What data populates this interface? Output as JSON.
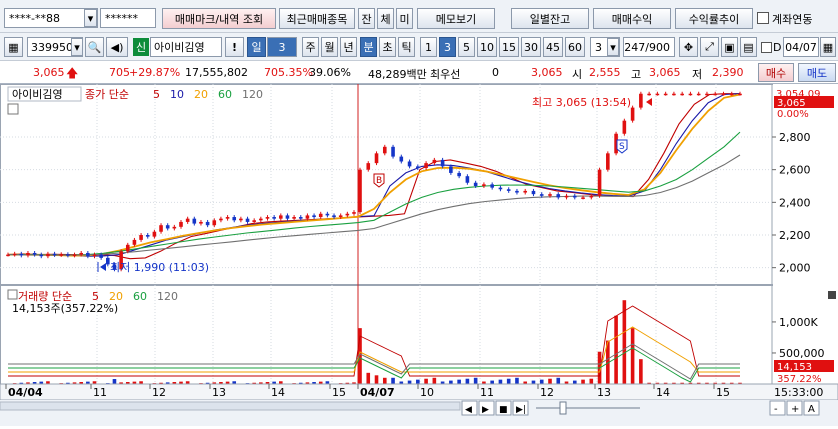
{
  "row1": {
    "account_masked": "****-**88",
    "password_masked": "******",
    "btn_trade_mark": "매매마크/내역 조회",
    "btn_recent_stock": "최근매매종목",
    "btn_balance": "잔",
    "btn_fill": "체",
    "btn_unfilled": "미",
    "btn_memo": "메모보기",
    "btn_daily_balance": "일별잔고",
    "btn_trade_profit": "매매수익",
    "btn_return_trend": "수익률추이",
    "link_account_label": "계좌연동"
  },
  "row2": {
    "stock_code": "339950",
    "credit_badge": "신",
    "stock_name": "아이비김영",
    "warn": "!",
    "period_day": "일",
    "period_num": "3",
    "week": "주",
    "month": "월",
    "year": "년",
    "minute": "분",
    "second": "초",
    "tick": "틱",
    "intervals": [
      "1",
      "3",
      "5",
      "10",
      "15",
      "30",
      "45",
      "60"
    ],
    "interval_value": "3",
    "page_count": "247/900",
    "d_label": "D",
    "date_value": "04/07"
  },
  "row3": {
    "price": "3,065",
    "change": "705",
    "change_pct": "+29.87%",
    "volume": "17,555,802",
    "volume_ratio": "705.35%",
    "turnover": "39.06%",
    "amount": "48,289백만",
    "priority_label": "최우선",
    "priority_value": "0",
    "ask": "3,065",
    "open_label": "시",
    "open": "2,555",
    "high_label": "고",
    "high": "3,065",
    "low_label": "저",
    "low": "2,390",
    "buy_label": "매수",
    "sell_label": "매도"
  },
  "chart_legend": {
    "name": "아이비김영",
    "main_label": "종가 단순",
    "ma": [
      "5",
      "10",
      "20",
      "60",
      "120"
    ],
    "vol_label": "거래량 단순",
    "vol_ma": [
      "5",
      "20",
      "60",
      "120"
    ],
    "vol_info": "14,153주(357.22%)"
  },
  "annotations": {
    "high_note": "최고 3,065 (13:54)",
    "low_note": "최저 1,990 (11:03)",
    "marker_buy": "B",
    "marker_sell": "S"
  },
  "price_axis": {
    "current_label": "3,065",
    "upper_limit": "3,054.09",
    "change_pct_label": "0.00%",
    "ticks": [
      "2,800",
      "2,600",
      "2,400",
      "2,200",
      "2,000"
    ]
  },
  "volume_axis": {
    "ticks": [
      "1,000K",
      "500,000"
    ],
    "current_label": "14,153",
    "current_pct": "357.22%"
  },
  "time_axis": {
    "labels": [
      "04/04",
      "11",
      "12",
      "13",
      "14",
      "15",
      "04/07",
      "10",
      "11",
      "12",
      "13",
      "14",
      "15"
    ],
    "clock": "15:33:00"
  },
  "scroll_controls": [
    "◀",
    "▶",
    "■",
    "▶|"
  ],
  "zoom_controls": [
    "-",
    "+",
    "A"
  ],
  "colors": {
    "up": "#e01010",
    "down": "#1535c8",
    "ma5": "#c00000",
    "ma10": "#1a1aa8",
    "ma20": "#f0a000",
    "ma60": "#1aa040",
    "ma120": "#707070",
    "day_separator": "#d02020"
  },
  "chart_data": {
    "type": "candlestick",
    "timeframe_minutes": 3,
    "sessions": [
      "04/04",
      "04/07"
    ],
    "price_range": [
      1900,
      3100
    ],
    "price_ticks": [
      2000,
      2200,
      2400,
      2600,
      2800
    ],
    "last_price": 3065,
    "day_high": 3065,
    "day_low": 2390,
    "prev_day_low": 1990,
    "close_series": [
      [
        2080,
        2085,
        2075,
        2090,
        2080,
        2070,
        2085,
        2078,
        2082,
        2075,
        2080,
        2090,
        2070,
        2080,
        2060,
        2020,
        1990,
        2100,
        2140,
        2170,
        2200,
        2190,
        2220,
        2260,
        2240,
        2250,
        2280,
        2300,
        2270,
        2280,
        2260,
        2290,
        2300,
        2310,
        2290,
        2300,
        2280,
        2290,
        2300,
        2310,
        2300,
        2320,
        2300,
        2310,
        2300,
        2320,
        2310,
        2330,
        2320,
        2310,
        2320,
        2330,
        2340
      ],
      [
        2600,
        2640,
        2700,
        2740,
        2680,
        2650,
        2620,
        2610,
        2640,
        2660,
        2620,
        2580,
        2560,
        2520,
        2500,
        2510,
        2490,
        2480,
        2470,
        2460,
        2470,
        2450,
        2440,
        2450,
        2430,
        2440,
        2430,
        2430,
        2440,
        2600,
        2700,
        2820,
        2900,
        2980,
        3065,
        3065,
        3065,
        3065,
        3065,
        3065,
        3065,
        3065,
        3065,
        3065,
        3065,
        3065,
        3065
      ]
    ],
    "ma_lines": {
      "5": [
        2080,
        2084,
        2080,
        2082,
        2080,
        2078,
        2080,
        2074,
        2055,
        2060,
        2100,
        2150,
        2190,
        2210,
        2230,
        2250,
        2270,
        2280,
        2285,
        2290,
        2295,
        2300,
        2305,
        2310,
        2315,
        2320,
        2330,
        2600,
        2650,
        2660,
        2640,
        2620,
        2590,
        2550,
        2510,
        2490,
        2470,
        2460,
        2450,
        2440,
        2438,
        2435,
        2540,
        2700,
        2880,
        3000,
        3060,
        3065,
        3065
      ],
      "10": [
        2080,
        2081,
        2080,
        2079,
        2075,
        2070,
        2072,
        2080,
        2110,
        2140,
        2170,
        2190,
        2210,
        2230,
        2245,
        2260,
        2270,
        2278,
        2285,
        2290,
        2298,
        2305,
        2312,
        2318,
        2500,
        2580,
        2620,
        2630,
        2625,
        2610,
        2590,
        2560,
        2530,
        2505,
        2485,
        2470,
        2458,
        2448,
        2442,
        2438,
        2470,
        2600,
        2760,
        2900,
        3010,
        3060,
        3065
      ],
      "20": [
        2080,
        2080,
        2079,
        2077,
        2074,
        2075,
        2085,
        2105,
        2130,
        2155,
        2175,
        2195,
        2212,
        2228,
        2242,
        2254,
        2264,
        2272,
        2280,
        2288,
        2296,
        2304,
        2312,
        2360,
        2460,
        2540,
        2590,
        2610,
        2612,
        2605,
        2590,
        2570,
        2548,
        2525,
        2505,
        2488,
        2474,
        2462,
        2452,
        2445,
        2480,
        2580,
        2720,
        2850,
        2960,
        3040,
        3060
      ],
      "60": [
        2080,
        2080,
        2079,
        2078,
        2078,
        2080,
        2088,
        2100,
        2115,
        2130,
        2145,
        2160,
        2175,
        2188,
        2200,
        2212,
        2222,
        2232,
        2242,
        2252,
        2260,
        2268,
        2276,
        2290,
        2340,
        2390,
        2430,
        2460,
        2480,
        2492,
        2500,
        2505,
        2506,
        2504,
        2500,
        2494,
        2486,
        2478,
        2470,
        2462,
        2470,
        2500,
        2540,
        2600,
        2670,
        2740,
        2830
      ],
      "120": [
        2080,
        2079,
        2078,
        2077,
        2077,
        2078,
        2082,
        2090,
        2098,
        2108,
        2118,
        2128,
        2138,
        2148,
        2158,
        2168,
        2178,
        2188,
        2196,
        2204,
        2212,
        2220,
        2228,
        2240,
        2270,
        2300,
        2330,
        2355,
        2375,
        2392,
        2405,
        2415,
        2424,
        2430,
        2434,
        2436,
        2438,
        2438,
        2437,
        2436,
        2442,
        2460,
        2490,
        2530,
        2580,
        2630,
        2690
      ]
    },
    "volume_ticks": [
      500000,
      1000000
    ],
    "volume_peak_bars": [
      {
        "session": "04/07",
        "position": "open",
        "value": 900000
      },
      {
        "session": "04/07",
        "position": "13:54 rally",
        "value": 1350000
      }
    ],
    "last_volume": 14153,
    "last_volume_pct": 357.22
  }
}
